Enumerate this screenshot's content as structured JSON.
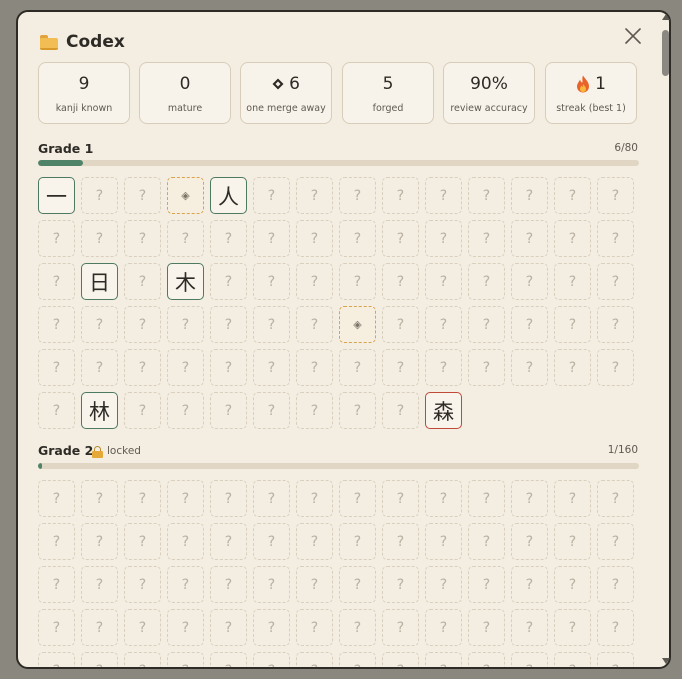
{
  "modal": {
    "title": "Codex",
    "title_icon": "folder-icon",
    "close_icon": "close-icon"
  },
  "stats": [
    {
      "value": "9",
      "label": "kanji known"
    },
    {
      "value": "0",
      "label": "mature"
    },
    {
      "value": "6",
      "label": "one merge away",
      "icon": "diamond-icon"
    },
    {
      "value": "5",
      "label": "forged"
    },
    {
      "value": "90%",
      "label": "review accuracy"
    },
    {
      "value": "1",
      "label": "streak (best 1)",
      "icon": "flame-icon"
    }
  ],
  "grades": [
    {
      "name": "Grade 1",
      "count": "6/80",
      "progress": 0.075,
      "locked": false,
      "placeholder": "?",
      "near_glyph": "◈",
      "cells": [
        [
          "一",
          "?",
          "?",
          "◈",
          "人",
          "?",
          "?",
          "?",
          "?",
          "?",
          "?",
          "?",
          "?",
          "?"
        ],
        [
          "?",
          "?",
          "?",
          "?",
          "?",
          "?",
          "?",
          "?",
          "?",
          "?",
          "?",
          "?",
          "?",
          "?"
        ],
        [
          "?",
          "日",
          "?",
          "木",
          "?",
          "?",
          "?",
          "?",
          "?",
          "?",
          "?",
          "?",
          "?",
          "?"
        ],
        [
          "?",
          "?",
          "?",
          "?",
          "?",
          "?",
          "?",
          "◈",
          "?",
          "?",
          "?",
          "?",
          "?",
          "?"
        ],
        [
          "?",
          "?",
          "?",
          "?",
          "?",
          "?",
          "?",
          "?",
          "?",
          "?",
          "?",
          "?",
          "?",
          "?"
        ],
        [
          "?",
          "林",
          "?",
          "?",
          "?",
          "?",
          "?",
          "?",
          "?",
          "森"
        ]
      ],
      "forged": [
        "森"
      ]
    },
    {
      "name": "Grade 2",
      "count": "1/160",
      "progress": 0.00625,
      "locked": true,
      "locked_label": "locked",
      "placeholder": "?"
    }
  ],
  "colors": {
    "accent": "#4f8468",
    "forged_border": "#c04a3a",
    "near_border": "#d9a24e",
    "background": "#f3ede2"
  }
}
